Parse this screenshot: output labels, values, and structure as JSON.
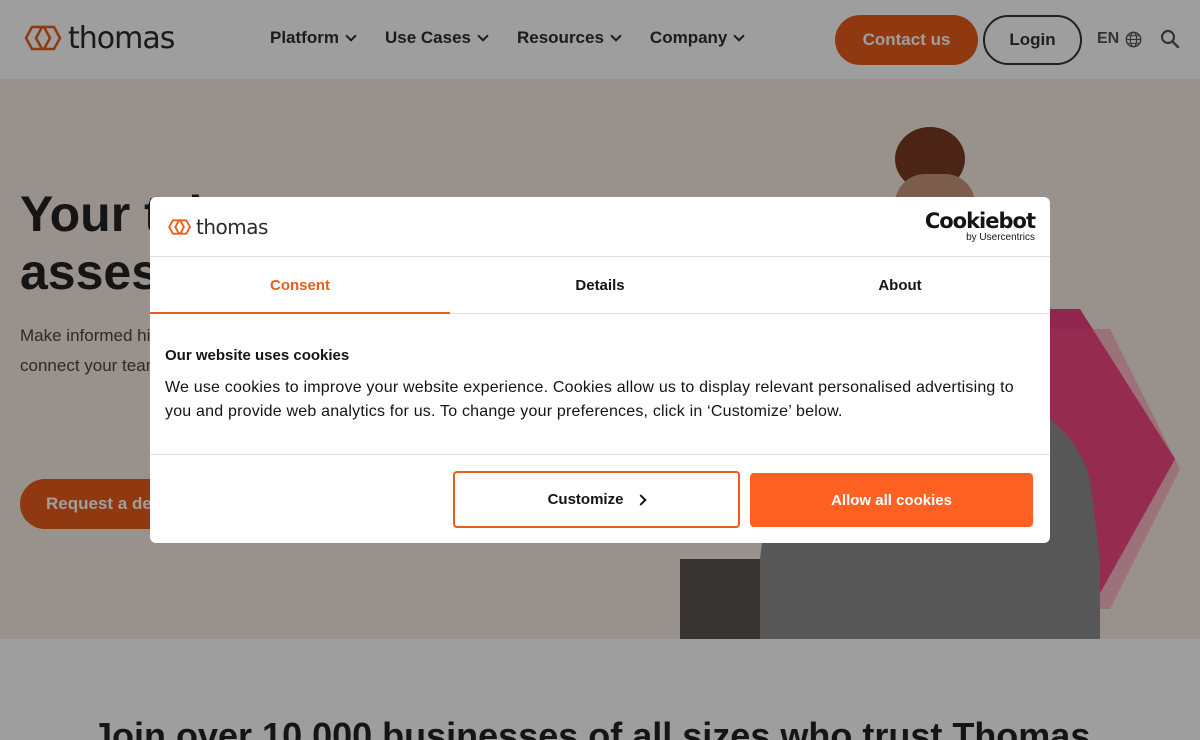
{
  "header": {
    "logo_text": "thomas",
    "nav": [
      {
        "label": "Platform"
      },
      {
        "label": "Use Cases"
      },
      {
        "label": "Resources"
      },
      {
        "label": "Company"
      }
    ],
    "contact_label": "Contact us",
    "login_label": "Login",
    "language": "EN"
  },
  "hero": {
    "title": "Your talent assessment platform",
    "subtitle": "Make informed hiring decisions and better connect your teams with people insights.",
    "cta_label": "Request a demo"
  },
  "below": {
    "title": "Join over 10,000 businesses of all sizes who trust Thomas"
  },
  "cookie_dialog": {
    "logo_text": "thomas",
    "cookiebot_name": "Cookiebot",
    "cookiebot_sub": "by Usercentrics",
    "tabs": [
      {
        "label": "Consent",
        "active": true
      },
      {
        "label": "Details",
        "active": false
      },
      {
        "label": "About",
        "active": false
      }
    ],
    "heading": "Our website uses cookies",
    "text": "We use cookies to improve your website experience. Cookies allow us to display relevant personalised advertising to you and provide web analytics for us. To change your preferences, click in ‘Customize’ below.",
    "customize_label": "Customize",
    "allow_label": "Allow all cookies"
  },
  "colors": {
    "brand_orange": "#e85d1a",
    "allow_button": "#ff6123",
    "hero_bg": "#f7ece2"
  }
}
